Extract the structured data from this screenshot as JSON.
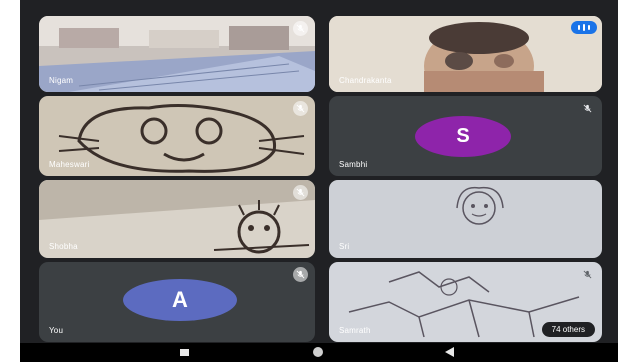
{
  "participants": [
    {
      "name": "Nigam",
      "mic": "muted",
      "speaking": false
    },
    {
      "name": "Chandrakanta",
      "mic": "on",
      "speaking": true
    },
    {
      "name": "Maheswari",
      "mic": "muted",
      "speaking": false
    },
    {
      "name": "Sambhi",
      "mic": "muted",
      "speaking": false,
      "avatar_letter": "S",
      "avatar_color": "#8e24aa"
    },
    {
      "name": "Shobha",
      "mic": "muted",
      "speaking": false
    },
    {
      "name": "Sri",
      "mic": "muted",
      "speaking": false
    },
    {
      "name": "You",
      "mic": "muted",
      "speaking": false,
      "avatar_letter": "A",
      "avatar_color": "#5c6bc0"
    },
    {
      "name": "Samrath",
      "mic": "muted",
      "speaking": false
    }
  ],
  "overflow": {
    "label": "74 others"
  },
  "nav_icons": [
    "recents-icon",
    "home-icon",
    "back-icon"
  ]
}
